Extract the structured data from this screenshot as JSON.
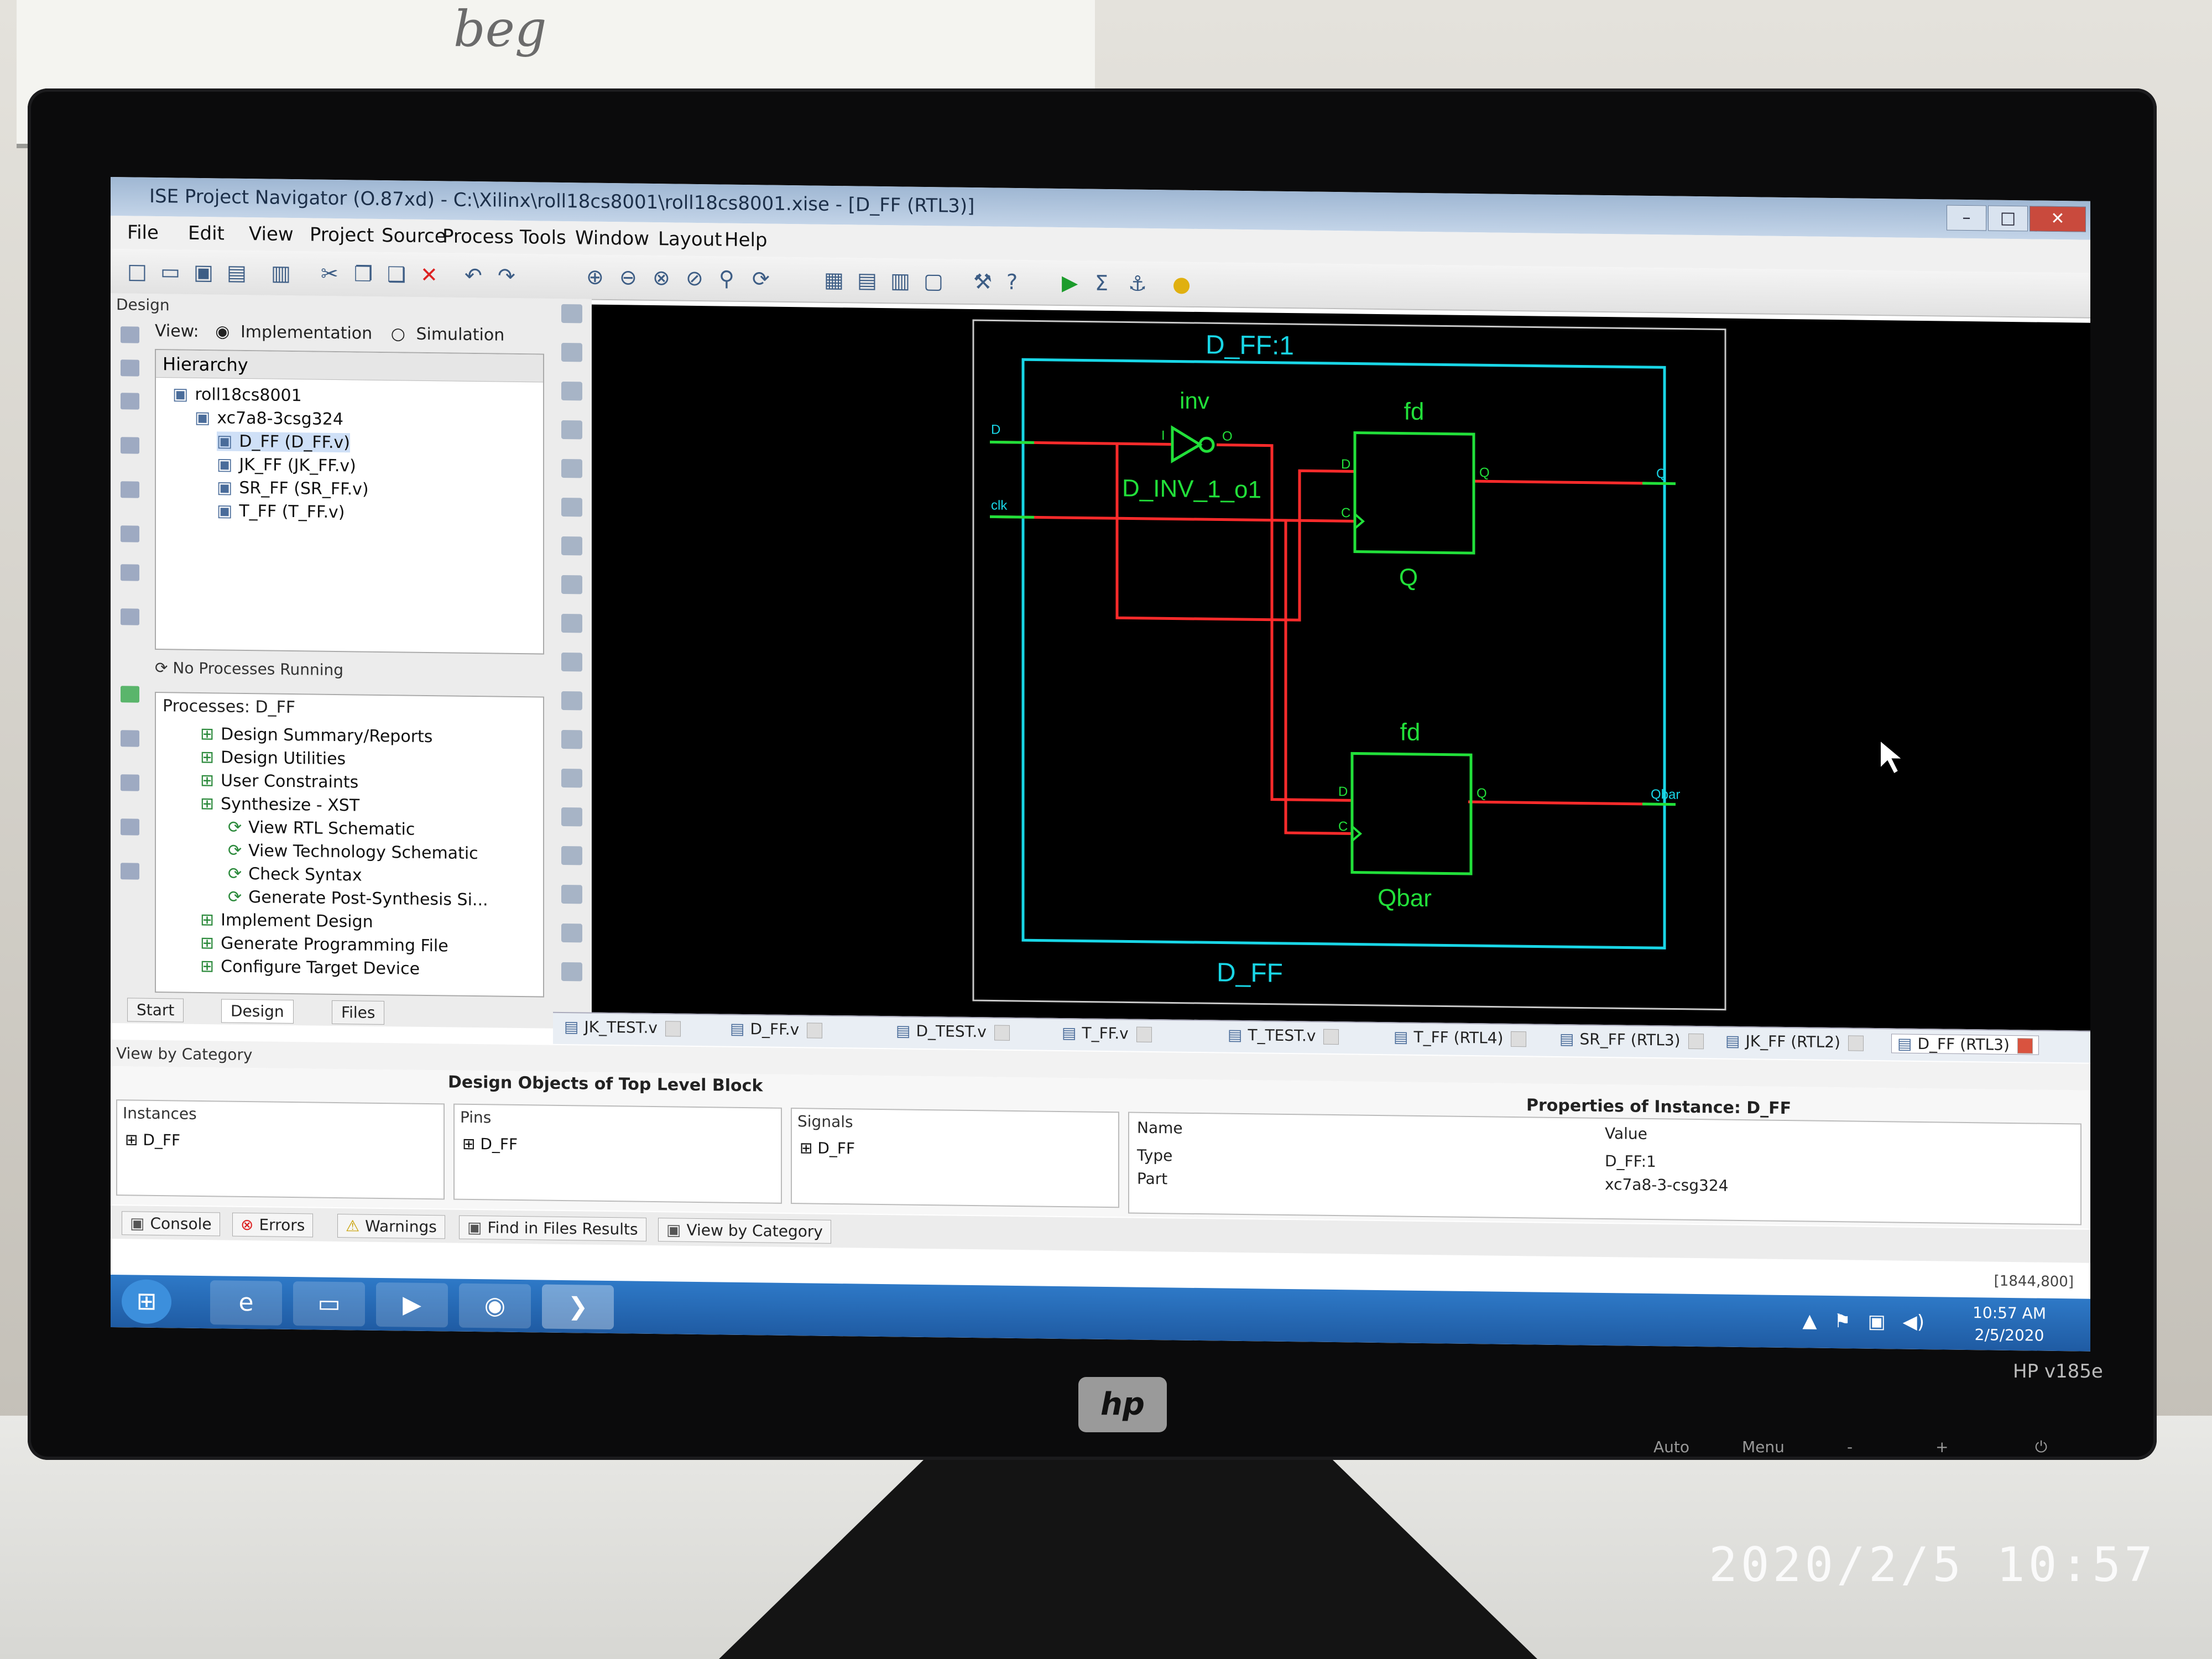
{
  "photo": {
    "whiteboard_sketch": "beg",
    "monitor_model": "HP v185e",
    "monitor_brand": "hp",
    "monitor_controls": [
      "Auto",
      "Menu",
      "-",
      "+"
    ],
    "timestamp": "2020/2/5  10:57"
  },
  "window": {
    "title": "ISE Project Navigator (O.87xd) - C:\\Xilinx\\roll18cs8001\\roll18cs8001.xise - [D_FF (RTL3)]",
    "menu": [
      "File",
      "Edit",
      "View",
      "Project",
      "Source",
      "Process",
      "Tools",
      "Window",
      "Layout",
      "Help"
    ]
  },
  "design_panel": {
    "title": "Design",
    "view_label": "View:",
    "view_options": [
      "Implementation",
      "Simulation"
    ],
    "hierarchy_header": "Hierarchy",
    "tree": [
      {
        "label": "roll18cs8001",
        "indent": 0
      },
      {
        "label": "xc7a8-3csg324",
        "indent": 1
      },
      {
        "label": "D_FF (D_FF.v)",
        "indent": 2,
        "selected": true
      },
      {
        "label": "JK_FF (JK_FF.v)",
        "indent": 2
      },
      {
        "label": "SR_FF (SR_FF.v)",
        "indent": 2
      },
      {
        "label": "T_FF (T_FF.v)",
        "indent": 2
      }
    ],
    "process_status": "No Processes Running",
    "processes_header": "Processes: D_FF",
    "processes": [
      {
        "label": "Design Summary/Reports",
        "indent": 1
      },
      {
        "label": "Design Utilities",
        "indent": 1
      },
      {
        "label": "User Constraints",
        "indent": 1
      },
      {
        "label": "Synthesize - XST",
        "indent": 1
      },
      {
        "label": "View RTL Schematic",
        "indent": 2
      },
      {
        "label": "View Technology Schematic",
        "indent": 2
      },
      {
        "label": "Check Syntax",
        "indent": 2
      },
      {
        "label": "Generate Post-Synthesis Si...",
        "indent": 2
      },
      {
        "label": "Implement Design",
        "indent": 1
      },
      {
        "label": "Generate Programming File",
        "indent": 1
      },
      {
        "label": "Configure Target Device",
        "indent": 1
      }
    ],
    "tabs": [
      "Start",
      "Design",
      "Files"
    ]
  },
  "schematic": {
    "outer_label": "D_FF:1",
    "bottom_label": "D_FF",
    "inv_type": "inv",
    "inv_name": "D_INV_1_o1",
    "inv_pin_in": "I",
    "inv_pin_out": "O",
    "ff1_type": "fd",
    "ff1_name": "Q",
    "ff2_type": "fd",
    "ff2_name": "Qbar",
    "pin_d": "D",
    "pin_c": "C",
    "pin_q": "Q",
    "port_d": "D",
    "port_clk": "clk",
    "port_q": "Q",
    "port_qbar": "Qbar",
    "colors": {
      "border": "#19d6e6",
      "component": "#22e03a",
      "wire": "#ff2b2b",
      "background": "#000000"
    }
  },
  "doc_tabs": [
    {
      "label": "JK_TEST.v"
    },
    {
      "label": "D_FF.v"
    },
    {
      "label": "D_TEST.v"
    },
    {
      "label": "T_FF.v"
    },
    {
      "label": "T_TEST.v"
    },
    {
      "label": "T_FF (RTL4)"
    },
    {
      "label": "SR_FF (RTL3)"
    },
    {
      "label": "JK_FF (RTL2)"
    },
    {
      "label": "D_FF (RTL3)",
      "active": true
    }
  ],
  "bottom_panel": {
    "view_by_category": "View by Category",
    "objects_title": "Design Objects of Top Level Block",
    "properties_title": "Properties of Instance: D_FF",
    "instances_header": "Instances",
    "instances_item": "D_FF",
    "pins_header": "Pins",
    "pins_item": "D_FF",
    "signals_header": "Signals",
    "signals_item": "D_FF",
    "props_name_header": "Name",
    "props_value_header": "Value",
    "props_rows": [
      {
        "name": "Type",
        "value": "D_FF:1"
      },
      {
        "name": "Part",
        "value": "xc7a8-3-csg324"
      }
    ],
    "console_tabs": [
      "Console",
      "Errors",
      "Warnings",
      "Find in Files Results",
      "View by Category"
    ],
    "status_coords": "[1844,800]"
  },
  "taskbar": {
    "time": "10:57 AM",
    "date": "2/5/2020"
  }
}
